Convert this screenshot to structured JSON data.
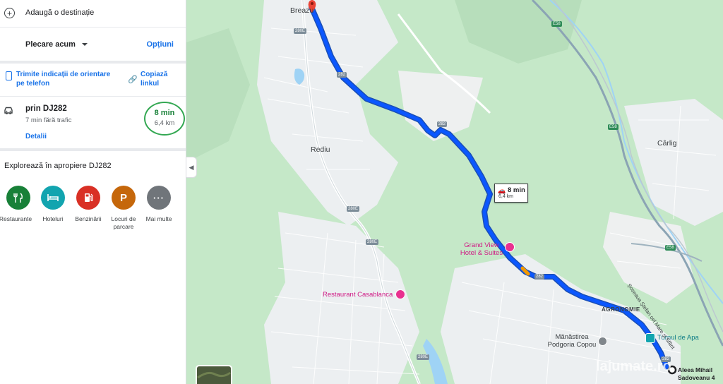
{
  "directions": {
    "add_destination": "Adaugă o destinație",
    "departure": "Plecare acum",
    "options": "Opțiuni",
    "send_to_phone": "Trimite indicații de orientare pe telefon",
    "copy_link": "Copiază linkul"
  },
  "route": {
    "name": "prin DJ282",
    "no_traffic": "7 min fără trafic",
    "details": "Detalii",
    "time": "8 min",
    "distance": "6,4 km"
  },
  "explore": {
    "title": "Explorează în apropiere DJ282",
    "items": [
      {
        "label": "Restaurante",
        "icon": "restaurant-icon",
        "color": "#188038"
      },
      {
        "label": "Hoteluri",
        "icon": "hotel-icon",
        "color": "#12a4af"
      },
      {
        "label": "Benzinării",
        "icon": "gas-station-icon",
        "color": "#d93025"
      },
      {
        "label": "Locuri de parcare",
        "icon": "parking-icon",
        "color": "#c5670b"
      },
      {
        "label": "Mai multe",
        "icon": "more-icon",
        "color": "#70757a"
      }
    ]
  },
  "map": {
    "places": {
      "breazu": "Breazu",
      "rediu": "Rediu",
      "carlig": "Cârlig",
      "agronomie": "AGRONOMIE"
    },
    "pois": {
      "grand_view": "Grand View Hotel & Suites",
      "casablanca": "Restaurant Casablanca",
      "turnul": "Turnul de Apa",
      "manastirea": "Mănăstirea Podgoria Copou",
      "sadoveanu": "Aleea Mihail Sadoveanu 4"
    },
    "street": "Șoseaua Ștefan cel Mare și Sfânt",
    "road_shields": [
      "280E",
      "282",
      "282",
      "280E",
      "280E",
      "282",
      "E58",
      "E58",
      "E58",
      "282",
      "280E"
    ],
    "route_callout": {
      "time": "8 min",
      "distance": "6,4 km"
    },
    "watermark": "lajumate.ro",
    "accent_color": "#1a73e8",
    "route_color": "#0b57ff"
  }
}
